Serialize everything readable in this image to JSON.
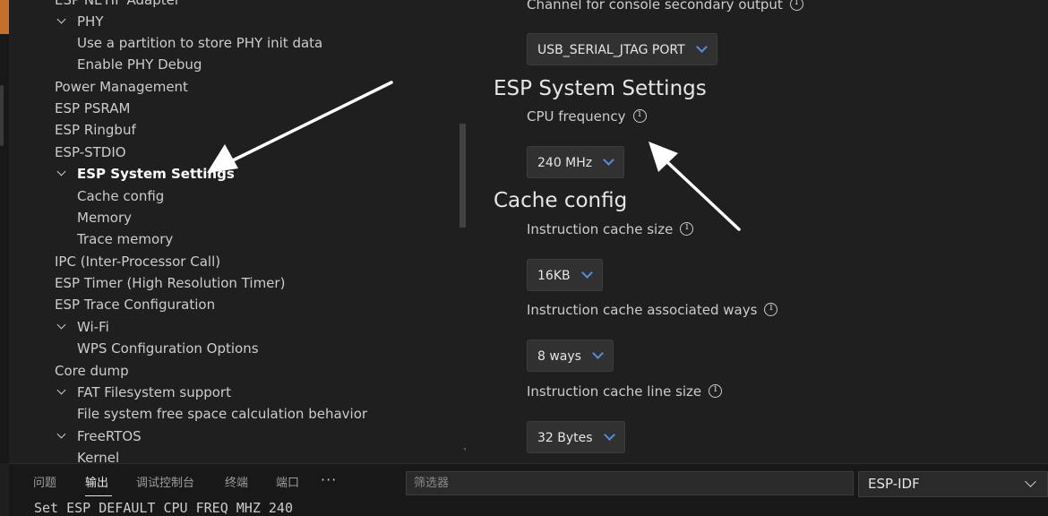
{
  "tree": {
    "items": [
      {
        "label": "ESP NETIF Adapter",
        "level": 0,
        "chevron": false,
        "bold": false
      },
      {
        "label": "PHY",
        "level": 1,
        "chevron": true,
        "bold": false
      },
      {
        "label": "Use a partition to store PHY init data",
        "level": 2,
        "chevron": false,
        "bold": false
      },
      {
        "label": "Enable PHY Debug",
        "level": 2,
        "chevron": false,
        "bold": false
      },
      {
        "label": "Power Management",
        "level": 0,
        "chevron": false,
        "bold": false
      },
      {
        "label": "ESP PSRAM",
        "level": 0,
        "chevron": false,
        "bold": false
      },
      {
        "label": "ESP Ringbuf",
        "level": 0,
        "chevron": false,
        "bold": false
      },
      {
        "label": "ESP-STDIO",
        "level": 0,
        "chevron": false,
        "bold": false
      },
      {
        "label": "ESP System Settings",
        "level": 1,
        "chevron": true,
        "bold": true
      },
      {
        "label": "Cache config",
        "level": 2,
        "chevron": false,
        "bold": false
      },
      {
        "label": "Memory",
        "level": 2,
        "chevron": false,
        "bold": false
      },
      {
        "label": "Trace memory",
        "level": 2,
        "chevron": false,
        "bold": false
      },
      {
        "label": "IPC (Inter-Processor Call)",
        "level": 0,
        "chevron": false,
        "bold": false
      },
      {
        "label": "ESP Timer (High Resolution Timer)",
        "level": 0,
        "chevron": false,
        "bold": false
      },
      {
        "label": "ESP Trace Configuration",
        "level": 0,
        "chevron": false,
        "bold": false
      },
      {
        "label": "Wi-Fi",
        "level": 1,
        "chevron": true,
        "bold": false
      },
      {
        "label": "WPS Configuration Options",
        "level": 2,
        "chevron": false,
        "bold": false
      },
      {
        "label": "Core dump",
        "level": 0,
        "chevron": false,
        "bold": false
      },
      {
        "label": "FAT Filesystem support",
        "level": 1,
        "chevron": true,
        "bold": false
      },
      {
        "label": "File system free space calculation behavior",
        "level": 2,
        "chevron": false,
        "bold": false
      },
      {
        "label": "FreeRTOS",
        "level": 1,
        "chevron": true,
        "bold": false
      },
      {
        "label": "Kernel",
        "level": 2,
        "chevron": false,
        "bold": false
      }
    ]
  },
  "settings": {
    "console_secondary_label": "Channel for console secondary output",
    "console_secondary_value": "USB_SERIAL_JTAG PORT",
    "system_title": "ESP System Settings",
    "cpu_freq_label": "CPU frequency",
    "cpu_freq_value": "240 MHz",
    "cache_title": "Cache config",
    "icache_size_label": "Instruction cache size",
    "icache_size_value": "16KB",
    "icache_ways_label": "Instruction cache associated ways",
    "icache_ways_value": "8 ways",
    "icache_line_label": "Instruction cache line size",
    "icache_line_value": "32 Bytes"
  },
  "panel": {
    "tabs": [
      "问题",
      "输出",
      "调试控制台",
      "终端",
      "端口"
    ],
    "active_tab": "输出",
    "more": "···",
    "filter_placeholder": "筛选器",
    "channel": "ESP-IDF",
    "output_line": "Set ESP DEFAULT CPU FREQ MHZ 240"
  },
  "colors": {
    "background": "#1f1f1f",
    "panel": "#181818",
    "accent_chevron": "#4f8ff0",
    "annotation_arrow": "#ffffff"
  },
  "icons": [
    "chevron-down-icon",
    "info-icon",
    "more-icon",
    "annotation-arrow"
  ]
}
